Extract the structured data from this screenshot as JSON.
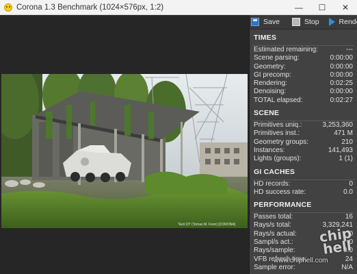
{
  "window": {
    "title": "Corona 1.3 Benchmark (1024×576px, 1:2)",
    "minimize_glyph": "—",
    "maximize_glyph": "☐",
    "close_glyph": "✕"
  },
  "render": {
    "caption": "\"Exit 23\" (Tomas M. Fenn) [CORONA]"
  },
  "toolbar": {
    "save_label": "Save",
    "stop_label": "Stop",
    "render_label": "Render"
  },
  "sections": {
    "times": {
      "title": "TIMES",
      "rows": [
        {
          "label": "Estimated remaining:",
          "value": "---"
        },
        {
          "label": "Scene parsing:",
          "value": "0:00:00"
        },
        {
          "label": "Geometry:",
          "value": "0:00:00"
        },
        {
          "label": "GI precomp:",
          "value": "0:00:00"
        },
        {
          "label": "Rendering:",
          "value": "0:02:25"
        },
        {
          "label": "Denoising:",
          "value": "0:00:00"
        },
        {
          "label": "TOTAL elapsed:",
          "value": "0:02:27"
        }
      ]
    },
    "scene": {
      "title": "SCENE",
      "rows": [
        {
          "label": "Primitives uniq.:",
          "value": "3,253,360"
        },
        {
          "label": "Primitives inst.:",
          "value": "471 M"
        },
        {
          "label": "Geometry groups:",
          "value": "210"
        },
        {
          "label": "Instances:",
          "value": "141,493"
        },
        {
          "label": "Lights (groups):",
          "value": "1 (1)"
        }
      ]
    },
    "gi_caches": {
      "title": "GI CACHES",
      "rows": [
        {
          "label": "HD records:",
          "value": "0"
        },
        {
          "label": "HD success rate:",
          "value": "0.0"
        }
      ]
    },
    "performance": {
      "title": "PERFORMANCE",
      "rows": [
        {
          "label": "Passes total:",
          "value": "16"
        },
        {
          "label": "Rays/s total:",
          "value": "3,329,241"
        },
        {
          "label": "Rays/s actual:",
          "value": "0"
        },
        {
          "label": "Sampl/s act.:",
          "value": "0"
        },
        {
          "label": "Rays/sample:",
          "value": "0.0"
        },
        {
          "label": "VFB refresh time:",
          "value": "24"
        },
        {
          "label": "Sample error:",
          "value": "N/A"
        }
      ]
    }
  },
  "watermark": {
    "logo_text": "chip hell",
    "url": "www.chiphell.com"
  },
  "colors": {
    "panel_bg": "#424242",
    "viewport_bg": "#262626",
    "render_accent": "#2b8ee6"
  }
}
